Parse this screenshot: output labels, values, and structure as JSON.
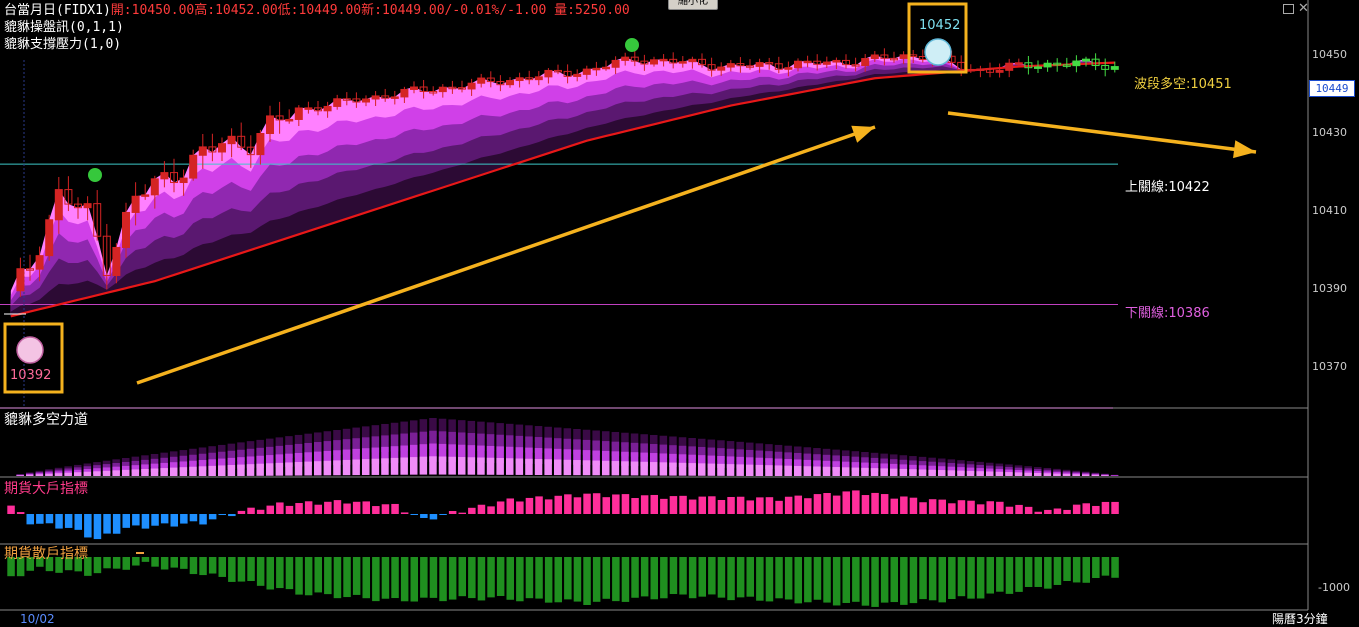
{
  "header": {
    "title": "台當月日(FIDX1)",
    "quote": "開:10450.00高:10452.00低:10449.00新:10449.00/-0.01%/-1.00 量:5250.00",
    "indicator1": "貔貅操盤訊(0,1,1)",
    "indicator2": "貔貅支撐壓力(1,0)"
  },
  "toolbar": {
    "minimize_label": "縮小化"
  },
  "colors": {
    "up": "#d42424",
    "down": "#d42424",
    "ma": "#e81818",
    "bands": [
      "#ff80ff",
      "#d040e8",
      "#9028b0",
      "#5a1870",
      "#2c0a34"
    ],
    "upper_line": "#3cc8c8",
    "lower_line": "#c040c0",
    "arrow": "#f5b21e",
    "bull": "#ff2e9a",
    "bear": "#1e8fff",
    "retail": "#1f8f1f"
  },
  "chart_data": [
    {
      "type": "candlestick",
      "title": "台當月日(FIDX1)",
      "y_ticks": [
        "10450",
        "10430",
        "10410",
        "10390",
        "10370"
      ],
      "ylim": [
        10360,
        10462
      ],
      "last_price": "10449",
      "annotations": {
        "wave_label": "波段多空:10451",
        "upper_line_label": "上關線:10422",
        "upper_line_value": 10422,
        "lower_line_label": "下關線:10386",
        "lower_line_value": 10386,
        "low_marker": "10392",
        "high_marker": "10452"
      },
      "anchors": [
        [
          0,
          10388
        ],
        [
          2,
          10396
        ],
        [
          5,
          10414
        ],
        [
          8,
          10409
        ],
        [
          10,
          10397
        ],
        [
          13,
          10413
        ],
        [
          17,
          10420
        ],
        [
          22,
          10427
        ],
        [
          25,
          10428
        ],
        [
          30,
          10436
        ],
        [
          40,
          10440
        ],
        [
          50,
          10443
        ],
        [
          60,
          10446
        ],
        [
          65,
          10449
        ],
        [
          75,
          10447
        ],
        [
          86,
          10448
        ],
        [
          95,
          10450
        ],
        [
          100,
          10446
        ],
        [
          110,
          10448
        ],
        [
          115,
          10447
        ]
      ],
      "ma_anchors": [
        [
          0,
          10383
        ],
        [
          15,
          10392
        ],
        [
          30,
          10404
        ],
        [
          45,
          10416
        ],
        [
          60,
          10428
        ],
        [
          75,
          10437
        ],
        [
          90,
          10444
        ],
        [
          105,
          10447
        ],
        [
          115,
          10448
        ]
      ],
      "x_start_label": "10/02"
    },
    {
      "type": "area",
      "title": "貔貅多空力道",
      "peak_index": 44
    },
    {
      "type": "bar",
      "title": "期貨大戶指標",
      "anchors": [
        [
          0,
          0.3
        ],
        [
          2,
          -0.3
        ],
        [
          6,
          -0.5
        ],
        [
          9,
          -0.9
        ],
        [
          12,
          -0.5
        ],
        [
          16,
          -0.4
        ],
        [
          20,
          -0.3
        ],
        [
          24,
          0.1
        ],
        [
          28,
          0.35
        ],
        [
          35,
          0.45
        ],
        [
          40,
          0.3
        ],
        [
          43,
          -0.2
        ],
        [
          46,
          0.05
        ],
        [
          52,
          0.5
        ],
        [
          60,
          0.7
        ],
        [
          70,
          0.6
        ],
        [
          80,
          0.55
        ],
        [
          88,
          0.8
        ],
        [
          95,
          0.5
        ],
        [
          103,
          0.4
        ],
        [
          108,
          0.1
        ],
        [
          112,
          0.35
        ],
        [
          115,
          0.4
        ]
      ]
    },
    {
      "type": "bar",
      "title": "期貨散戶指標",
      "y_ticks": [
        "-1000"
      ],
      "anchors": [
        [
          0,
          0.4
        ],
        [
          3,
          0.25
        ],
        [
          8,
          0.35
        ],
        [
          14,
          0.15
        ],
        [
          20,
          0.35
        ],
        [
          30,
          0.75
        ],
        [
          40,
          0.9
        ],
        [
          50,
          0.85
        ],
        [
          60,
          0.95
        ],
        [
          70,
          0.8
        ],
        [
          80,
          0.9
        ],
        [
          90,
          1.0
        ],
        [
          100,
          0.85
        ],
        [
          110,
          0.55
        ],
        [
          115,
          0.4
        ]
      ]
    }
  ],
  "footer": {
    "period": "陽曆3分鐘"
  }
}
